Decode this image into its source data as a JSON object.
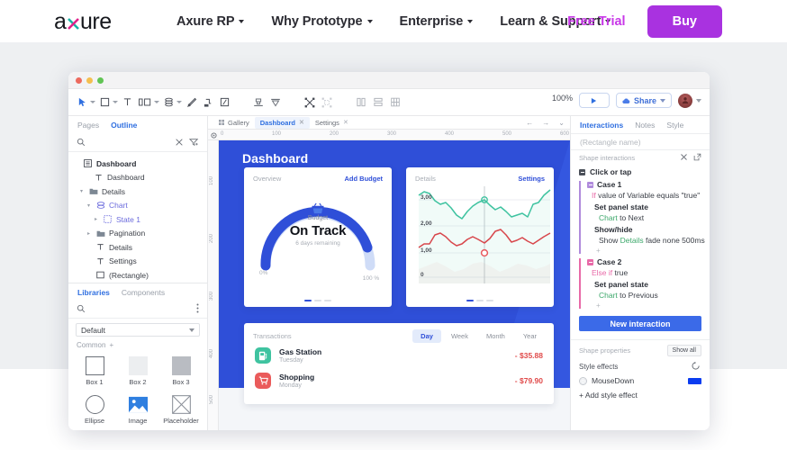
{
  "site_header": {
    "logo_text": "axure",
    "nav": [
      {
        "label": "Axure RP",
        "has_caret": true
      },
      {
        "label": "Why Prototype",
        "has_caret": true
      },
      {
        "label": "Enterprise",
        "has_caret": true
      },
      {
        "label": "Learn & Support",
        "has_caret": true
      }
    ],
    "free_trial": "Free Trial",
    "buy": "Buy",
    "colors": {
      "buy_bg": "#a932e0",
      "free_trial": "#c838e8",
      "nav_text": "#2c2c33"
    }
  },
  "app": {
    "toolbar": {
      "zoom_value": "100%",
      "share_label": "Share",
      "icons": [
        "pointer-tool",
        "rectangle-tool",
        "text-tool",
        "dynamic-panel-tool",
        "repeater-tool",
        "pen-tool",
        "connector-tool",
        "slice-tool",
        "align-tool",
        "distribute-tool",
        "group-tool",
        "ungroup-tool",
        "layout-columns",
        "layout-rows",
        "layout-grid"
      ]
    },
    "left_panel": {
      "tabs": [
        {
          "label": "Pages",
          "active": false
        },
        {
          "label": "Outline",
          "active": true
        }
      ],
      "search_placeholder": "",
      "tree": [
        {
          "label": "Dashboard",
          "indent": 0,
          "icon": "page-icon",
          "arrow": "",
          "bold": true,
          "purple": false
        },
        {
          "label": "Dashboard",
          "indent": 1,
          "icon": "text-icon",
          "arrow": "",
          "bold": false,
          "purple": false
        },
        {
          "label": "Details",
          "indent": 1,
          "icon": "group-icon",
          "arrow": "▾",
          "bold": false,
          "purple": false
        },
        {
          "label": "Chart",
          "indent": 2,
          "icon": "panel-icon",
          "arrow": "▾",
          "bold": false,
          "purple": true
        },
        {
          "label": "State 1",
          "indent": 3,
          "icon": "state-icon",
          "arrow": "▸",
          "bold": false,
          "purple": true
        },
        {
          "label": "Pagination",
          "indent": 2,
          "icon": "group-icon",
          "arrow": "▸",
          "bold": false,
          "purple": false
        },
        {
          "label": "Details",
          "indent": 2,
          "icon": "text-icon",
          "arrow": "",
          "bold": false,
          "purple": false
        },
        {
          "label": "Settings",
          "indent": 2,
          "icon": "text-icon",
          "arrow": "",
          "bold": false,
          "purple": false
        },
        {
          "label": "(Rectangle)",
          "indent": 2,
          "icon": "rectangle-icon",
          "arrow": "",
          "bold": false,
          "purple": false
        }
      ],
      "library": {
        "tabs": [
          {
            "label": "Libraries",
            "active": true
          },
          {
            "label": "Components",
            "active": false
          }
        ],
        "selected_library": "Default",
        "group_label": "Common",
        "widgets": [
          {
            "label": "Box 1",
            "shape": "box1"
          },
          {
            "label": "Box 2",
            "shape": "box2"
          },
          {
            "label": "Box 3",
            "shape": "box3"
          },
          {
            "label": "Ellipse",
            "shape": "ellipse"
          },
          {
            "label": "Image",
            "shape": "image"
          },
          {
            "label": "Placeholder",
            "shape": "placeholder"
          }
        ]
      }
    },
    "canvas": {
      "tabs": [
        {
          "label": "Gallery",
          "active": false,
          "closable": false
        },
        {
          "label": "Dashboard",
          "active": true,
          "closable": true
        },
        {
          "label": "Settings",
          "active": false,
          "closable": true
        }
      ],
      "ruler_h": [
        "0",
        "100",
        "200",
        "300",
        "400",
        "500",
        "600"
      ],
      "ruler_v": [
        "100",
        "200",
        "300",
        "400",
        "500"
      ],
      "title": "Dashboard",
      "overview_card": {
        "header_left": "Overview",
        "header_right": "Add Budget",
        "gauge_label": "Budget",
        "gauge_value": "On Track",
        "gauge_sub": "6 days remaining",
        "min_label": "0%",
        "max_label": "100 %",
        "gauge_percent": 78,
        "pager": [
          true,
          false,
          false
        ]
      },
      "details_card": {
        "header_left": "Details",
        "header_right": "Settings",
        "y_ticks": [
          "3,00",
          "2,00",
          "1,00",
          "0"
        ],
        "pager": [
          true,
          false,
          false
        ]
      },
      "transactions_card": {
        "title": "Transactions",
        "segments": [
          {
            "label": "Day",
            "active": true
          },
          {
            "label": "Week",
            "active": false
          },
          {
            "label": "Month",
            "active": false
          },
          {
            "label": "Year",
            "active": false
          }
        ],
        "rows": [
          {
            "icon": "gas-pump-icon",
            "icon_color": "green",
            "name": "Gas Station",
            "day": "Tuesday",
            "amount": "- $35.88"
          },
          {
            "icon": "shopping-cart-icon",
            "icon_color": "red",
            "name": "Shopping",
            "day": "Monday",
            "amount": "- $79.90"
          }
        ]
      }
    },
    "right_panel": {
      "tabs": [
        {
          "label": "Interactions",
          "active": true
        },
        {
          "label": "Notes",
          "active": false
        },
        {
          "label": "Style",
          "active": false
        }
      ],
      "name_placeholder": "(Rectangle name)",
      "section_label": "Shape interactions",
      "event_label": "Click or tap",
      "cases": [
        {
          "title": "Case 1",
          "condition_keyword": "If",
          "condition_text": "value of Variable equals \"true\"",
          "actions": [
            {
              "name": "Set panel state",
              "target": "Chart",
              "detail": "to Next"
            },
            {
              "name": "Show/hide",
              "prefix": "Show",
              "target": "Details",
              "detail": "fade none 500ms"
            }
          ]
        },
        {
          "title": "Case 2",
          "condition_keyword": "Else if",
          "condition_text": "true",
          "actions": [
            {
              "name": "Set panel state",
              "target": "Chart",
              "detail": "to Previous"
            }
          ]
        }
      ],
      "new_interaction_label": "New interaction",
      "properties_label": "Shape properties",
      "show_all_label": "Show all",
      "style_effects_label": "Style effects",
      "mousedown_label": "MouseDown",
      "mousedown_color": "#0a3cf0",
      "add_style_effect_label": "+ Add style effect"
    }
  }
}
